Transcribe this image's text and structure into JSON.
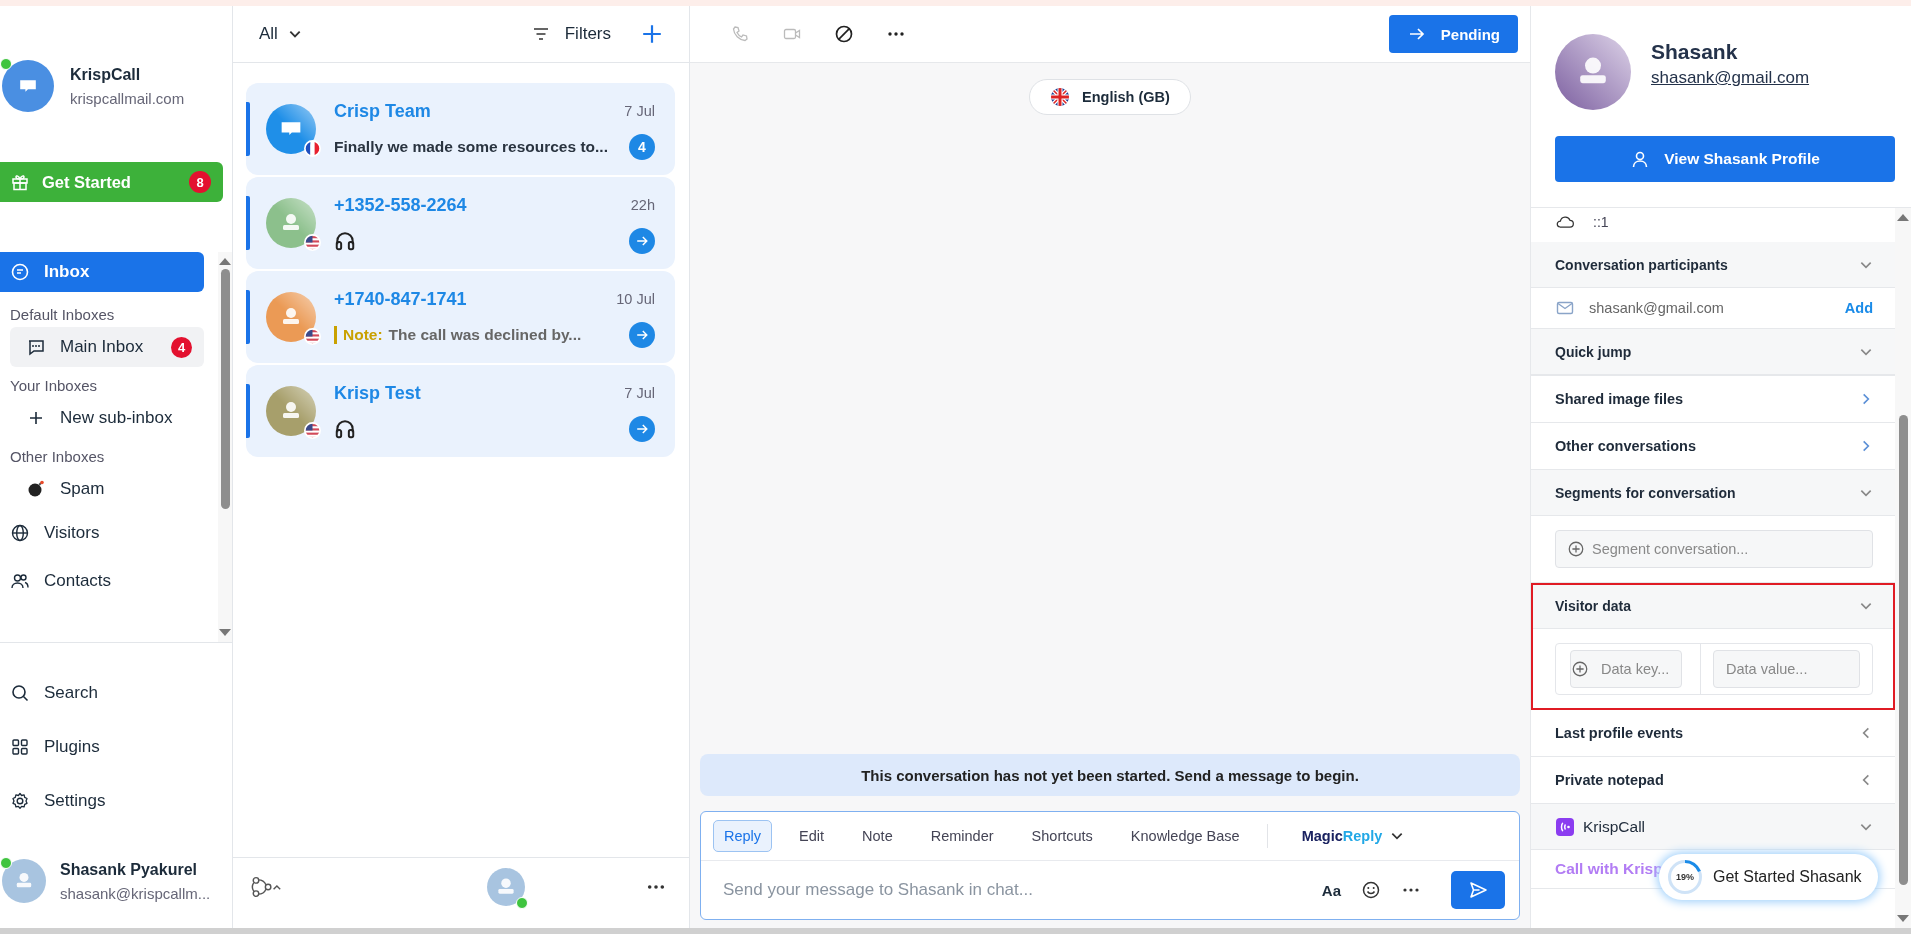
{
  "sidebar": {
    "account": {
      "name": "KrispCall",
      "email": "krispcallmail.com",
      "online": true
    },
    "get_started": {
      "label": "Get Started",
      "count": "8"
    },
    "nav": [
      {
        "kind": "item",
        "label": "Inbox",
        "selected": true
      },
      {
        "kind": "heading",
        "label": "Default Inboxes"
      },
      {
        "kind": "sub",
        "label": "Main Inbox",
        "count": "4",
        "selected": false
      },
      {
        "kind": "heading",
        "label": "Your Inboxes"
      },
      {
        "kind": "sub",
        "label": "New sub-inbox",
        "selected": false
      },
      {
        "kind": "heading",
        "label": "Other Inboxes"
      },
      {
        "kind": "sub",
        "label": "Spam",
        "selected": false
      },
      {
        "kind": "item",
        "label": "Visitors",
        "selected": false
      },
      {
        "kind": "item",
        "label": "Contacts",
        "selected": false
      }
    ],
    "bottom_nav": [
      {
        "label": "Search"
      },
      {
        "label": "Plugins"
      },
      {
        "label": "Settings"
      }
    ],
    "user": {
      "name": "Shasank Pyakurel",
      "email": "shasank@krispcallm...",
      "online": true
    }
  },
  "conversation_list": {
    "filter": "All",
    "filters_label": "Filters",
    "conversations": [
      {
        "kind": "team",
        "name": "Crisp Team",
        "time": "7 Jul",
        "color": "#1f8fe8",
        "preview": "Finally we made some resources to...",
        "unread": "4"
      },
      {
        "kind": "audio",
        "name": "+1352-558-2264",
        "time": "22h",
        "color": "#8cc08c"
      },
      {
        "kind": "note",
        "name": "+1740-847-1741",
        "time": "10 Jul",
        "color": "#eb9a55",
        "note_label": "Note:",
        "preview": "The call was declined by..."
      },
      {
        "kind": "audio",
        "name": "Krisp Test",
        "time": "7 Jul",
        "color": "#a79f6b"
      }
    ],
    "footer": {
      "online": true
    }
  },
  "chat": {
    "status_button": "Pending",
    "language": "English (GB)",
    "notice": "This conversation has not yet been started. Send a message to begin.",
    "composer_tabs": [
      {
        "label": "Reply",
        "selected": true
      },
      {
        "label": "Edit",
        "selected": false
      },
      {
        "label": "Note",
        "selected": false
      },
      {
        "label": "Reminder",
        "selected": false
      },
      {
        "label": "Shortcuts",
        "selected": false
      },
      {
        "label": "Knowledge Base",
        "selected": false
      }
    ],
    "magic_reply": [
      "Magic",
      "Reply"
    ],
    "placeholder": "Send your message to Shasank in chat...",
    "format_label": "Aa"
  },
  "profile": {
    "name": "Shasank",
    "email": "shasank@gmail.com",
    "view_button": "View Shasank Profile",
    "ip": "::1",
    "sections": [
      {
        "kind": "collapsible",
        "title": "Conversation participants",
        "participant": "shasank@gmail.com",
        "action": "Add",
        "highlighted": false
      },
      {
        "kind": "collapsible",
        "title": "Quick jump",
        "highlighted": false
      },
      {
        "kind": "link",
        "title": "Shared image files",
        "highlighted": false
      },
      {
        "kind": "link",
        "title": "Other conversations",
        "highlighted": false
      },
      {
        "kind": "collapsible",
        "title": "Segments for conversation",
        "placeholder": "Segment conversation...",
        "highlighted": false
      },
      {
        "kind": "collapsible",
        "title": "Visitor data",
        "key_placeholder": "Data key...",
        "value_placeholder": "Data value...",
        "highlighted": true
      },
      {
        "kind": "closed",
        "title": "Last profile events",
        "highlighted": false
      },
      {
        "kind": "closed",
        "title": "Private notepad",
        "highlighted": false
      },
      {
        "kind": "plugin",
        "title": "KrispCall",
        "link": "Call with Krisp",
        "highlighted": false
      }
    ]
  },
  "onboarding_popup": {
    "label": "Get Started Shasank",
    "level": 0.19,
    "reading": "19%"
  }
}
